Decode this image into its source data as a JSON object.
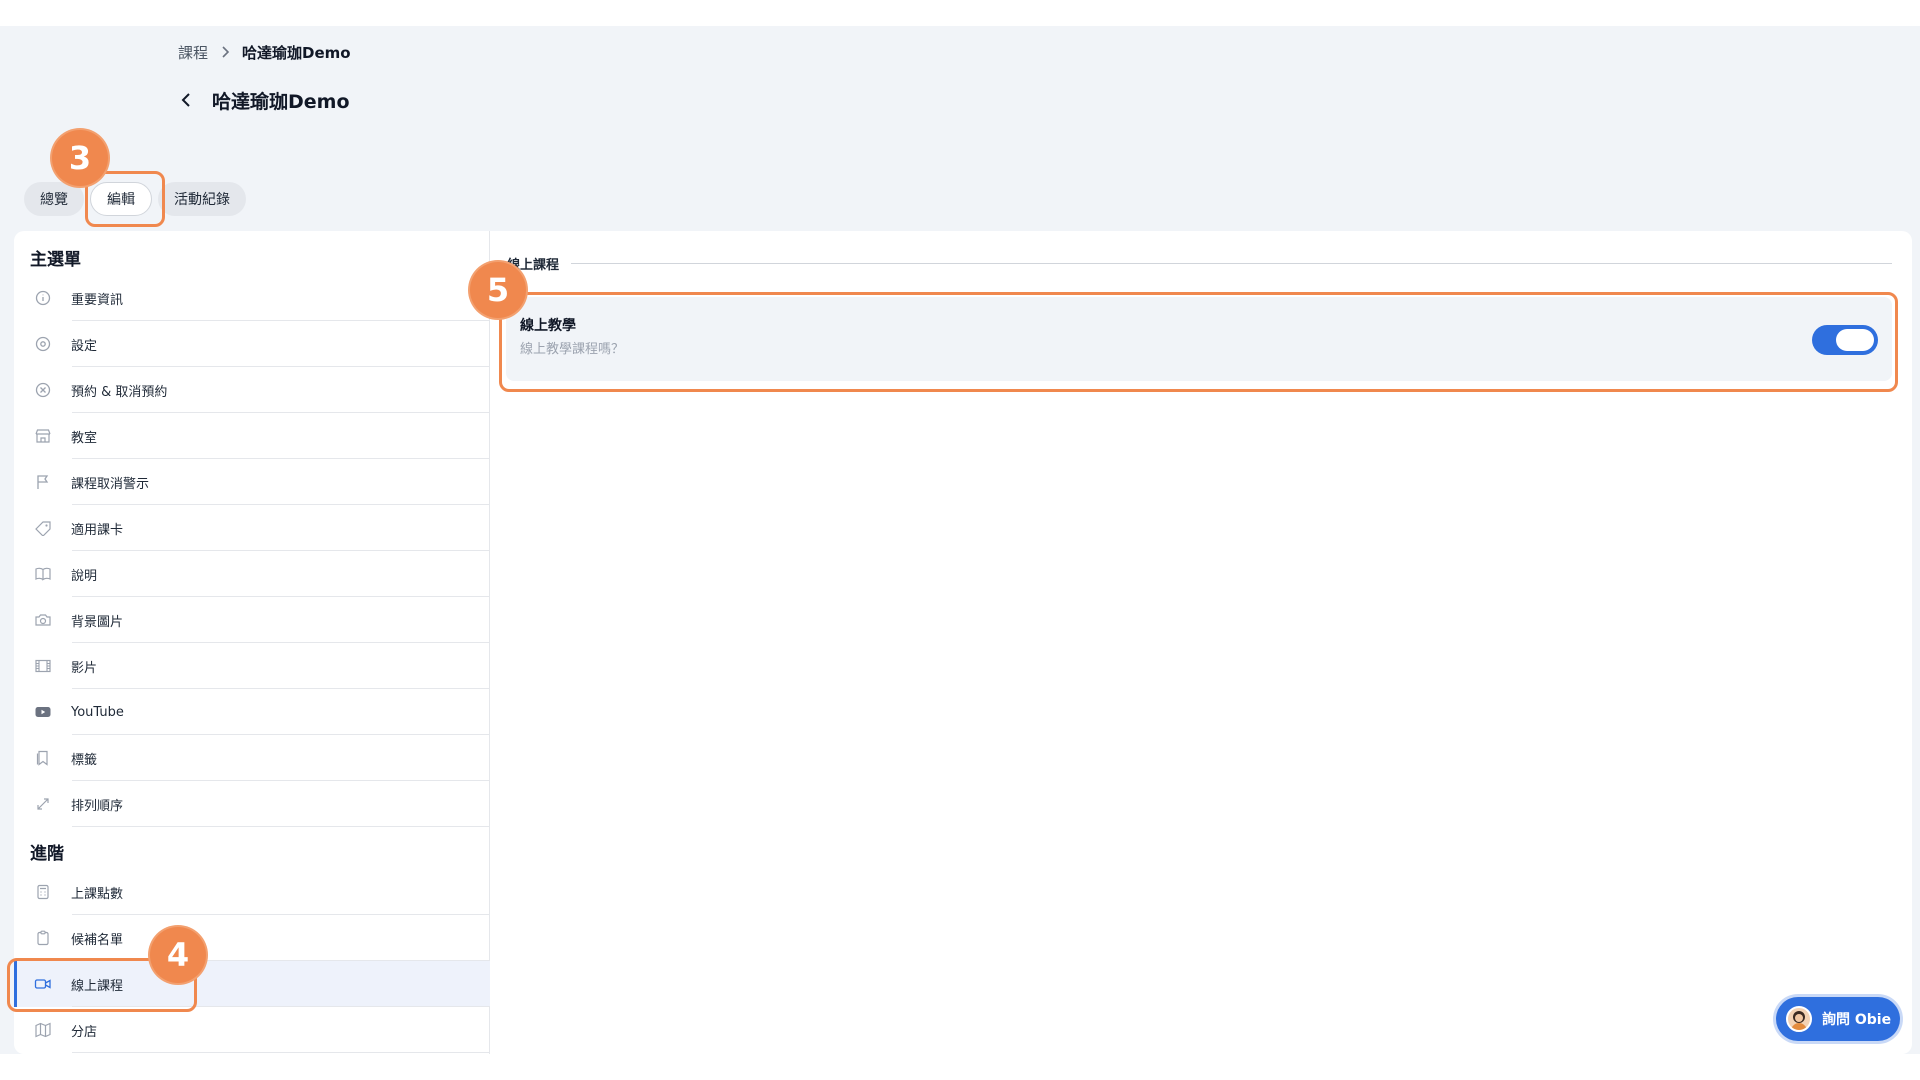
{
  "breadcrumb": {
    "parent": "課程",
    "current": "哈達瑜珈Demo"
  },
  "page": {
    "title": "哈達瑜珈Demo"
  },
  "tabs": [
    {
      "label": "總覽"
    },
    {
      "label": "編輯"
    },
    {
      "label": "活動紀錄"
    }
  ],
  "steps": {
    "tab_step": "3",
    "menu_step": "4",
    "setting_step": "5"
  },
  "sidebar": {
    "main_title": "主選單",
    "main_items": [
      {
        "label": "重要資訊",
        "icon": "info-icon"
      },
      {
        "label": "設定",
        "icon": "settings-icon"
      },
      {
        "label": "預約 & 取消預約",
        "icon": "cancel-circle-icon"
      },
      {
        "label": "教室",
        "icon": "storefront-icon"
      },
      {
        "label": "課程取消警示",
        "icon": "flag-icon"
      },
      {
        "label": "適用課卡",
        "icon": "tag-icon"
      },
      {
        "label": "說明",
        "icon": "book-icon"
      },
      {
        "label": "背景圖片",
        "icon": "camera-icon"
      },
      {
        "label": "影片",
        "icon": "film-icon"
      },
      {
        "label": "YouTube",
        "icon": "youtube-icon"
      },
      {
        "label": "標籤",
        "icon": "bookmark-icon"
      },
      {
        "label": "排列順序",
        "icon": "arrows-expand-icon"
      }
    ],
    "advanced_title": "進階",
    "advanced_items": [
      {
        "label": "上課點數",
        "icon": "calculator-icon"
      },
      {
        "label": "候補名單",
        "icon": "clipboard-icon"
      },
      {
        "label": "線上課程",
        "icon": "video-camera-icon"
      },
      {
        "label": "分店",
        "icon": "map-icon"
      }
    ]
  },
  "content": {
    "section_title": "線上課程",
    "setting": {
      "title": "線上教學",
      "subtitle": "線上教學課程嗎？",
      "enabled": true
    }
  },
  "chat": {
    "label": "詢問 Obie"
  },
  "colors": {
    "accent": "#2f6fde",
    "highlight": "#f0884e",
    "background": "#f1f4f8"
  }
}
